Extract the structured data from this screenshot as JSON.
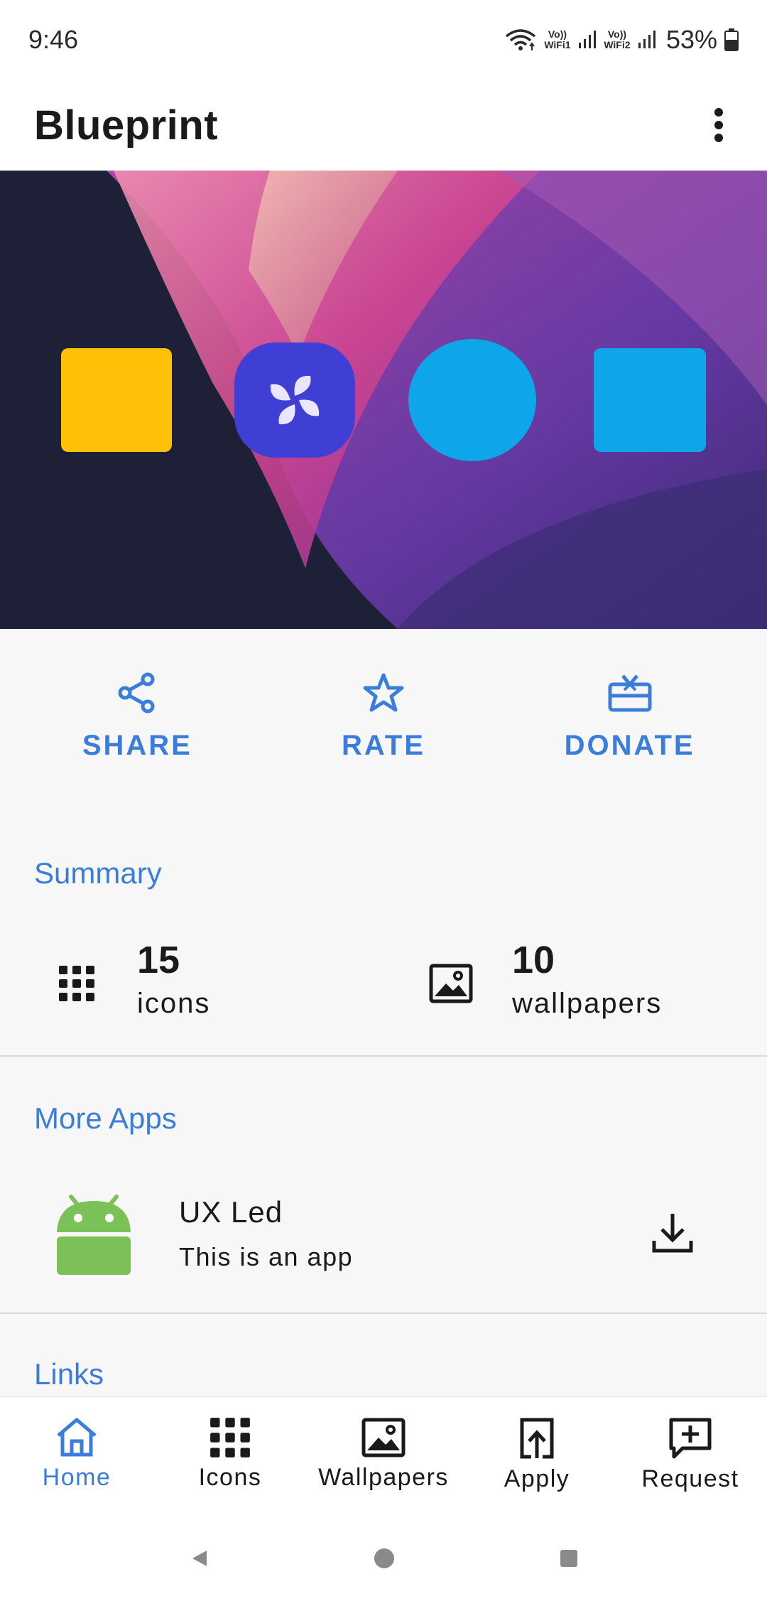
{
  "status_bar": {
    "time": "9:46",
    "volte1": "Vo)) WiFi1",
    "volte2": "Vo)) WiFi2",
    "battery": "53%"
  },
  "app_bar": {
    "title": "Blueprint",
    "menu_icon": "more-vert-icon"
  },
  "hero": {
    "icons": [
      "yellow-square-icon",
      "pinwheel-app-icon",
      "blue-circle-icon",
      "blue-square-icon"
    ]
  },
  "actions": [
    {
      "label": "SHARE",
      "icon": "share-icon"
    },
    {
      "label": "RATE",
      "icon": "star-icon"
    },
    {
      "label": "DONATE",
      "icon": "gift-icon"
    }
  ],
  "summary": {
    "title": "Summary",
    "icons_count": "15",
    "icons_label": "icons",
    "wallpapers_count": "10",
    "wallpapers_label": "wallpapers"
  },
  "more_apps": {
    "title": "More Apps",
    "apps": [
      {
        "name": "UX Led",
        "description": "This is an app",
        "icon": "android-icon",
        "action_icon": "download-icon"
      }
    ]
  },
  "links": {
    "title": "Links"
  },
  "bottom_nav": [
    {
      "label": "Home",
      "icon": "home-icon",
      "active": true
    },
    {
      "label": "Icons",
      "icon": "grid-icon",
      "active": false
    },
    {
      "label": "Wallpapers",
      "icon": "image-icon",
      "active": false
    },
    {
      "label": "Apply",
      "icon": "apply-icon",
      "active": false
    },
    {
      "label": "Request",
      "icon": "request-icon",
      "active": false
    }
  ],
  "colors": {
    "accent": "#3b7ddb",
    "hero_yellow": "#ffc107",
    "hero_indigo": "#3f3fd6",
    "hero_blue": "#0ea5e9",
    "android_green": "#7cc158"
  }
}
